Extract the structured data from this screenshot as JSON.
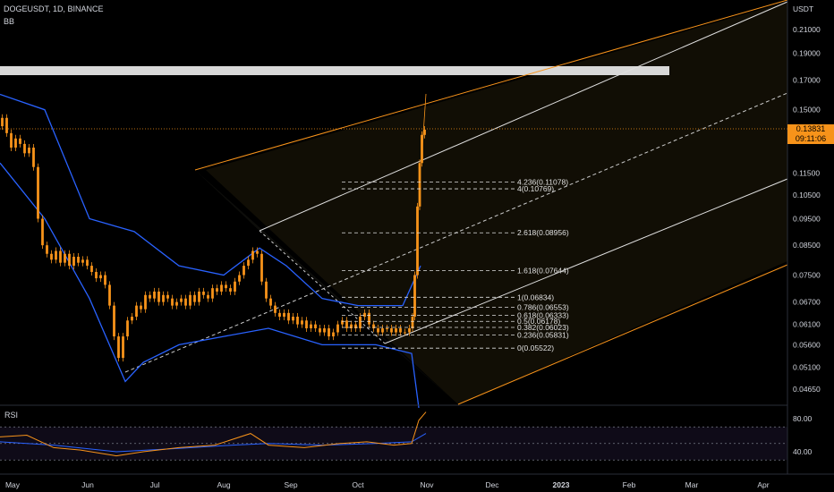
{
  "header": {
    "symbol": "DOGEUSDT, 1D, BINANCE",
    "indicator": "BB"
  },
  "rsi_panel": {
    "label": "RSI",
    "ticks": [
      "80.00",
      "40.00"
    ]
  },
  "current": {
    "price": "0.13831",
    "countdown": "09:11:06"
  },
  "colors": {
    "background": "#000000",
    "candle": "#f7931a",
    "bands": "#2962ff",
    "pitchfork_outer": "#f7931a",
    "pitchfork_inner": "#e0e0e0",
    "rsi_line": "#f7931a",
    "rsi_ma": "#2962ff",
    "highlight_zone": "#d8d8d8"
  },
  "chart_data": {
    "type": "candlestick",
    "title": "DOGEUSDT, 1D, BINANCE",
    "y_axis_label": "USDT",
    "y_scale": "log",
    "y_ticks": [
      "0.21000",
      "0.19000",
      "0.17000",
      "0.15000",
      "0.13500",
      "0.11500",
      "0.10500",
      "0.09500",
      "0.08500",
      "0.07500",
      "0.06700",
      "0.06100",
      "0.05600",
      "0.05100",
      "0.04650"
    ],
    "x_ticks": [
      "May",
      "Jun",
      "Jul",
      "Aug",
      "Sep",
      "Oct",
      "Nov",
      "Dec",
      "2023",
      "Feb",
      "Mar",
      "Apr"
    ],
    "last_price": 0.13831,
    "price_path": [
      [
        0,
        0.14
      ],
      [
        5,
        0.145
      ],
      [
        10,
        0.136
      ],
      [
        15,
        0.128
      ],
      [
        20,
        0.133
      ],
      [
        25,
        0.13
      ],
      [
        30,
        0.125
      ],
      [
        35,
        0.128
      ],
      [
        40,
        0.118
      ],
      [
        45,
        0.095
      ],
      [
        50,
        0.085
      ],
      [
        55,
        0.082
      ],
      [
        60,
        0.08
      ],
      [
        65,
        0.083
      ],
      [
        70,
        0.079
      ],
      [
        75,
        0.082
      ],
      [
        80,
        0.078
      ],
      [
        85,
        0.081
      ],
      [
        90,
        0.079
      ],
      [
        95,
        0.08
      ],
      [
        100,
        0.078
      ],
      [
        105,
        0.076
      ],
      [
        110,
        0.074
      ],
      [
        115,
        0.075
      ],
      [
        120,
        0.072
      ],
      [
        125,
        0.066
      ],
      [
        130,
        0.058
      ],
      [
        135,
        0.053
      ],
      [
        140,
        0.058
      ],
      [
        145,
        0.062
      ],
      [
        150,
        0.063
      ],
      [
        155,
        0.066
      ],
      [
        160,
        0.065
      ],
      [
        165,
        0.069
      ],
      [
        170,
        0.068
      ],
      [
        175,
        0.07
      ],
      [
        180,
        0.067
      ],
      [
        185,
        0.069
      ],
      [
        190,
        0.068
      ],
      [
        195,
        0.066
      ],
      [
        200,
        0.067
      ],
      [
        205,
        0.068
      ],
      [
        210,
        0.066
      ],
      [
        215,
        0.069
      ],
      [
        220,
        0.067
      ],
      [
        225,
        0.07
      ],
      [
        230,
        0.069
      ],
      [
        235,
        0.068
      ],
      [
        240,
        0.071
      ],
      [
        245,
        0.07
      ],
      [
        250,
        0.072
      ],
      [
        255,
        0.071
      ],
      [
        260,
        0.07
      ],
      [
        265,
        0.073
      ],
      [
        270,
        0.075
      ],
      [
        275,
        0.078
      ],
      [
        280,
        0.08
      ],
      [
        285,
        0.083
      ],
      [
        290,
        0.082
      ],
      [
        295,
        0.073
      ],
      [
        300,
        0.068
      ],
      [
        305,
        0.066
      ],
      [
        310,
        0.064
      ],
      [
        315,
        0.063
      ],
      [
        320,
        0.064
      ],
      [
        325,
        0.062
      ],
      [
        330,
        0.063
      ],
      [
        335,
        0.061
      ],
      [
        340,
        0.062
      ],
      [
        345,
        0.06
      ],
      [
        350,
        0.061
      ],
      [
        355,
        0.06
      ],
      [
        360,
        0.059
      ],
      [
        365,
        0.06
      ],
      [
        370,
        0.058
      ],
      [
        375,
        0.059
      ],
      [
        380,
        0.061
      ],
      [
        385,
        0.062
      ],
      [
        390,
        0.06
      ],
      [
        395,
        0.061
      ],
      [
        400,
        0.06
      ],
      [
        405,
        0.063
      ],
      [
        410,
        0.064
      ],
      [
        415,
        0.061
      ],
      [
        420,
        0.06
      ],
      [
        425,
        0.059
      ],
      [
        430,
        0.06
      ],
      [
        435,
        0.06
      ],
      [
        440,
        0.059
      ],
      [
        445,
        0.06
      ],
      [
        450,
        0.059
      ],
      [
        455,
        0.059
      ],
      [
        460,
        0.06
      ],
      [
        462,
        0.063
      ],
      [
        465,
        0.075
      ],
      [
        468,
        0.1
      ],
      [
        470,
        0.12
      ],
      [
        473,
        0.135
      ],
      [
        476,
        0.138
      ]
    ],
    "bollinger": {
      "upper": [
        [
          0,
          0.16
        ],
        [
          50,
          0.15
        ],
        [
          100,
          0.095
        ],
        [
          150,
          0.09
        ],
        [
          200,
          0.078
        ],
        [
          250,
          0.075
        ],
        [
          290,
          0.084
        ],
        [
          320,
          0.078
        ],
        [
          360,
          0.068
        ],
        [
          400,
          0.066
        ],
        [
          450,
          0.066
        ],
        [
          470,
          0.078
        ]
      ],
      "lower": [
        [
          0,
          0.12
        ],
        [
          50,
          0.095
        ],
        [
          100,
          0.068
        ],
        [
          140,
          0.048
        ],
        [
          160,
          0.052
        ],
        [
          200,
          0.056
        ],
        [
          250,
          0.058
        ],
        [
          300,
          0.06
        ],
        [
          360,
          0.056
        ],
        [
          420,
          0.056
        ],
        [
          460,
          0.054
        ],
        [
          468,
          0.043
        ]
      ]
    },
    "fibonacci": [
      {
        "label": "4.236(0.11078)",
        "value": 0.11078
      },
      {
        "label": "4(0.10769)",
        "value": 0.10769
      },
      {
        "label": "2.618(0.08956)",
        "value": 0.08956
      },
      {
        "label": "1.618(0.07644)",
        "value": 0.07644
      },
      {
        "label": "1(0.06834)",
        "value": 0.06834
      },
      {
        "label": "0.786(0.06553)",
        "value": 0.06553
      },
      {
        "label": "0.618(0.06333)",
        "value": 0.06333
      },
      {
        "label": "0.5(0.06178)",
        "value": 0.06178
      },
      {
        "label": "0.382(0.06023)",
        "value": 0.06023
      },
      {
        "label": "0.236(0.05831)",
        "value": 0.05831
      },
      {
        "label": "0(0.05522)",
        "value": 0.05522
      }
    ],
    "rsi": {
      "ticks": [
        80,
        40
      ],
      "line": [
        [
          0,
          58
        ],
        [
          30,
          60
        ],
        [
          60,
          45
        ],
        [
          90,
          42
        ],
        [
          130,
          35
        ],
        [
          160,
          40
        ],
        [
          200,
          45
        ],
        [
          240,
          48
        ],
        [
          280,
          62
        ],
        [
          300,
          48
        ],
        [
          340,
          45
        ],
        [
          380,
          50
        ],
        [
          410,
          52
        ],
        [
          440,
          48
        ],
        [
          460,
          50
        ],
        [
          468,
          78
        ],
        [
          476,
          88
        ]
      ],
      "ma": [
        [
          0,
          52
        ],
        [
          60,
          48
        ],
        [
          130,
          40
        ],
        [
          200,
          44
        ],
        [
          260,
          48
        ],
        [
          300,
          50
        ],
        [
          360,
          48
        ],
        [
          420,
          50
        ],
        [
          460,
          52
        ],
        [
          476,
          62
        ]
      ]
    }
  }
}
